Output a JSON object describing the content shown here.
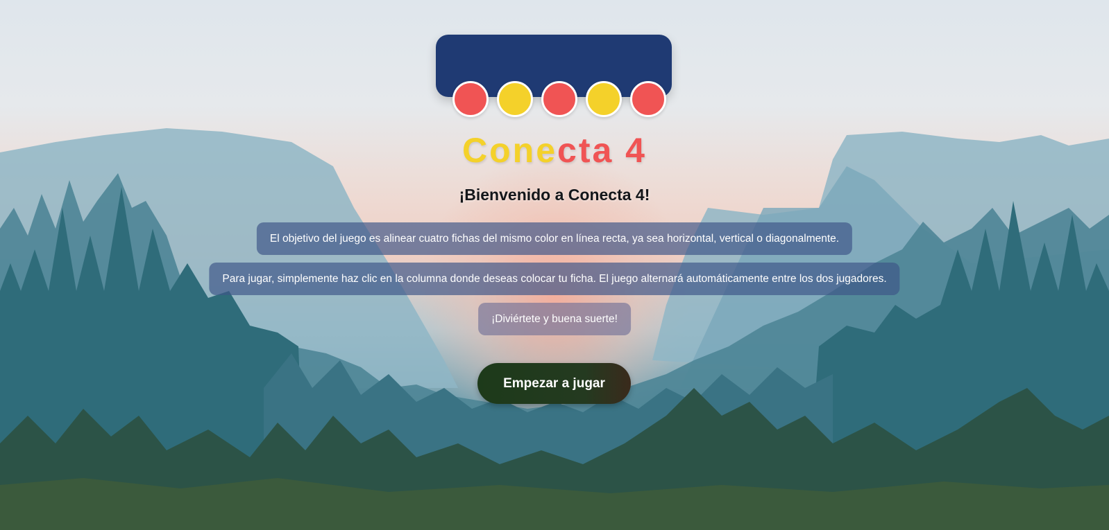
{
  "colors": {
    "logo_box": "#1f3a73",
    "red": "#f05454",
    "yellow": "#f4d12a",
    "button": "#1d3a1a"
  },
  "logo": {
    "discs": [
      "red",
      "yellow",
      "red",
      "yellow",
      "red"
    ]
  },
  "title": {
    "part1": "Cone",
    "part2": "cta 4"
  },
  "welcome": "¡Bienvenido a Conecta 4!",
  "instructions": {
    "objective": "El objetivo del juego es alinear cuatro fichas del mismo color en línea recta, ya sea horizontal, vertical o diagonalmente.",
    "how_to_play": "Para jugar, simplemente haz clic en la columna donde deseas colocar tu ficha. El juego alternará automáticamente entre los dos jugadores.",
    "good_luck": "¡Diviértete y buena suerte!"
  },
  "start_button": "Empezar a jugar"
}
